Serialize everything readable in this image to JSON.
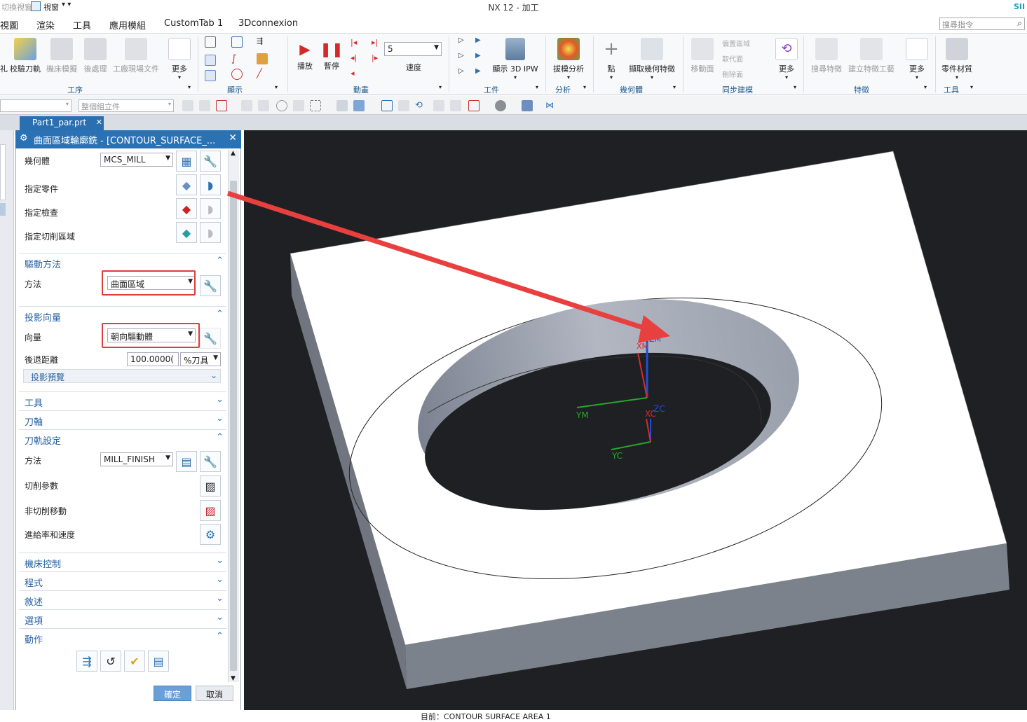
{
  "titlebar": {
    "left_label": "切換視窗",
    "window_label": "視窗",
    "title": "NX 12 - 加工",
    "brand": "SII"
  },
  "menu": {
    "items": [
      "視圖",
      "渲染",
      "工具",
      "應用模組",
      "CustomTab 1",
      "3Dconnexion"
    ],
    "search_placeholder": "搜尋指令"
  },
  "ribbon": {
    "buttons": [
      {
        "label": "校驗刀軌",
        "dim": false
      },
      {
        "label": "機床模擬",
        "dim": true
      },
      {
        "label": "後處理",
        "dim": true
      },
      {
        "label": "工廠現場文件",
        "dim": true
      },
      {
        "label": "更多",
        "dim": false
      },
      {
        "label": "播放",
        "dim": false
      },
      {
        "label": "暫停",
        "dim": false
      },
      {
        "label": "速度",
        "dim": false
      },
      {
        "label": "顯示 3D IPW",
        "dim": false
      },
      {
        "label": "拔模分析",
        "dim": false
      },
      {
        "label": "點",
        "dim": false
      },
      {
        "label": "擷取幾何特徵",
        "dim": false
      },
      {
        "label": "移動面",
        "dim": true
      },
      {
        "label": "更多",
        "dim": false
      },
      {
        "label": "搜尋特徵",
        "dim": true
      },
      {
        "label": "建立特徵工藝",
        "dim": true
      },
      {
        "label": "更多",
        "dim": false
      },
      {
        "label": "零件材質",
        "dim": false
      }
    ],
    "small_labels": [
      "偏置區域",
      "取代面",
      "刪除面"
    ],
    "speed_value": "5",
    "groups": [
      "工序",
      "顯示",
      "動畫",
      "工件",
      "分析",
      "幾何體",
      "同步建模",
      "特徵",
      "工具"
    ]
  },
  "toolbar2": {
    "filter_placeholder": "整個組立件"
  },
  "tab": {
    "label": "Part1_par.prt"
  },
  "dialog": {
    "title": "曲面區域輪廓銑 - [CONTOUR_SURFACE_...",
    "geometry": {
      "label": "幾何體",
      "value": "MCS_MILL"
    },
    "rows": [
      "指定零件",
      "指定檢查",
      "指定切削區域"
    ],
    "drive": {
      "header": "驅動方法",
      "method_label": "方法",
      "method_value": "曲面區域"
    },
    "projection": {
      "header": "投影向量",
      "vector_label": "向量",
      "vector_value": "朝向驅動體",
      "retract_label": "後退距離",
      "retract_value": "100.0000(",
      "retract_unit": "%刀具",
      "preview": "投影預覽"
    },
    "tool_header": "工具",
    "axis_header": "刀軸",
    "path": {
      "header": "刀軌設定",
      "method_label": "方法",
      "method_value": "MILL_FINISH",
      "rows": [
        "切削參數",
        "非切削移動",
        "進給率和速度"
      ]
    },
    "collapsed": [
      "機床控制",
      "程式",
      "敘述",
      "選項"
    ],
    "actions_header": "動作",
    "ok": "確定",
    "cancel": "取消"
  },
  "axes": {
    "xm": "XM",
    "zm": "ZM",
    "ym": "YM",
    "xc": "XC",
    "yc": "YC",
    "zc": "ZC"
  },
  "colors": {
    "accent": "#2b72b5",
    "highlight": "#e23b3b",
    "viewport": "#1f2023"
  },
  "status": {
    "text": "目前：CONTOUR SURFACE AREA 1"
  }
}
